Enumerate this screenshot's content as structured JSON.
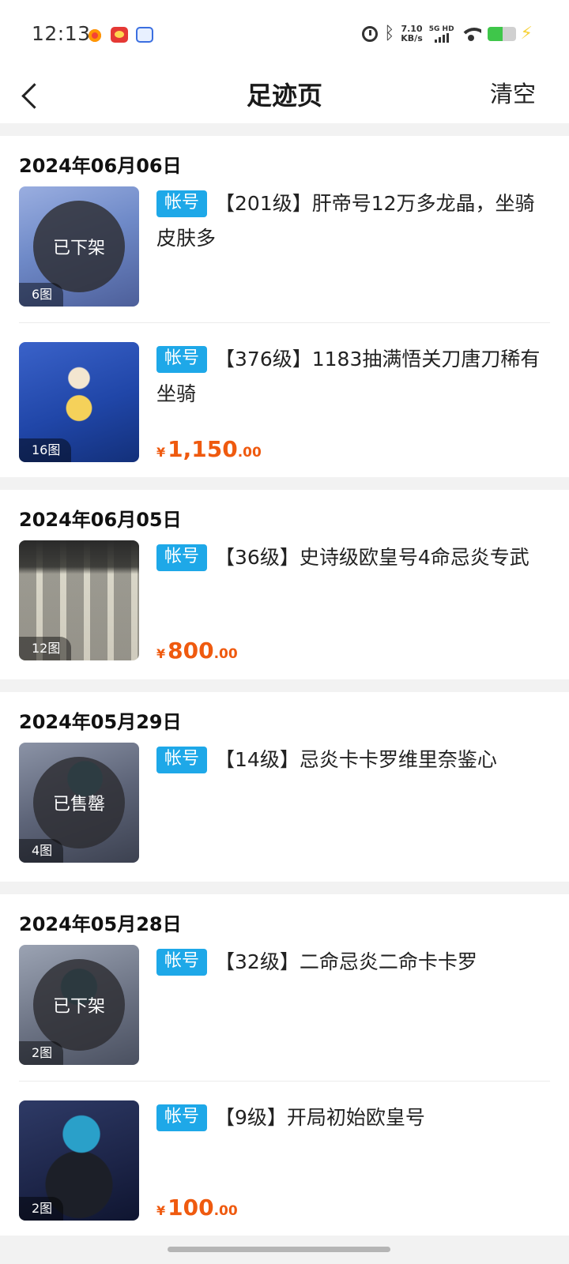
{
  "status_bar": {
    "time": "12:13",
    "net_speed_value": "7.10",
    "net_speed_unit": "KB/s",
    "network_type": "5G HD",
    "battery_level": 0.55,
    "icons": [
      "notification-icon",
      "weibo-icon",
      "baidu-icon",
      "alarm-icon",
      "bluetooth-icon",
      "signal-icon",
      "wifi-icon",
      "battery-icon",
      "charging-icon"
    ]
  },
  "header": {
    "back_icon": "back-arrow-icon",
    "title": "足迹页",
    "clear_label": "清空"
  },
  "groups": [
    {
      "date": "2024年06月06日",
      "items": [
        {
          "tag": "帐号",
          "title": "【201级】肝帝号12万多龙晶，坐骑皮肤多",
          "image_count": "6图",
          "status": "已下架",
          "price_int": "",
          "price_dec": "",
          "currency": ""
        },
        {
          "tag": "帐号",
          "title": "【376级】1183抽满悟关刀唐刀稀有坐骑",
          "image_count": "16图",
          "status": "",
          "price_int": "1,150",
          "price_dec": ".00",
          "currency": "¥"
        }
      ]
    },
    {
      "date": "2024年06月05日",
      "items": [
        {
          "tag": "帐号",
          "title": "【36级】史诗级欧皇号4命忌炎专武",
          "image_count": "12图",
          "status": "",
          "price_int": "800",
          "price_dec": ".00",
          "currency": "¥"
        }
      ]
    },
    {
      "date": "2024年05月29日",
      "items": [
        {
          "tag": "帐号",
          "title": "【14级】忌炎卡卡罗维里奈鉴心",
          "image_count": "4图",
          "status": "已售罄",
          "price_int": "",
          "price_dec": "",
          "currency": ""
        }
      ]
    },
    {
      "date": "2024年05月28日",
      "items": [
        {
          "tag": "帐号",
          "title": "【32级】二命忌炎二命卡卡罗",
          "image_count": "2图",
          "status": "已下架",
          "price_int": "",
          "price_dec": "",
          "currency": ""
        },
        {
          "tag": "帐号",
          "title": "【9级】开局初始欧皇号",
          "image_count": "2图",
          "status": "",
          "price_int": "100",
          "price_dec": ".00",
          "currency": "¥"
        }
      ]
    }
  ],
  "colors": {
    "tag_bg": "#1ea8e8",
    "price": "#ef5a0f",
    "page_bg": "#f2f2f2"
  }
}
